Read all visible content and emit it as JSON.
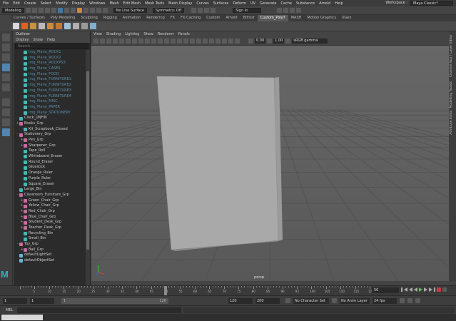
{
  "menubar": {
    "items": [
      "File",
      "Edit",
      "Create",
      "Select",
      "Modify",
      "Display",
      "Windows",
      "Mesh",
      "Edit Mesh",
      "Mesh Tools",
      "Mesh Display",
      "Curves",
      "Surfaces",
      "Deform",
      "UV",
      "Generate",
      "Cache",
      "Substance",
      "Arnold",
      "Help"
    ],
    "workspace_label": "Workspace :",
    "workspace_value": "Maya Classic*"
  },
  "statusline": {
    "mode": "Modeling",
    "live_surface": "No Live Surface",
    "symmetry": "Symmetry: Off",
    "sign_in": "Sign In"
  },
  "shelf_tabs": [
    "Curves / Surfaces",
    "Poly Modeling",
    "Sculpting",
    "Rigging",
    "Animation",
    "Rendering",
    "FX",
    "FX Caching",
    "Custom",
    "Arnold",
    "Bifrost",
    "Custom_PolyT",
    "MASH",
    "Motion Graphics",
    "XGen"
  ],
  "shelf_active_tab": "Custom_PolyT",
  "outliner": {
    "title": "Outliner",
    "menu": [
      "Display",
      "Show",
      "Help"
    ],
    "search_placeholder": "Search...",
    "nodes": [
      {
        "label": "Img_Plane_ROCK1",
        "indent": 1,
        "dim": true,
        "icon": "mesh"
      },
      {
        "label": "Img_Plane_ROCK2",
        "indent": 1,
        "dim": true,
        "icon": "mesh"
      },
      {
        "label": "Img_Plane_ROCKPS3",
        "indent": 1,
        "dim": true,
        "icon": "mesh"
      },
      {
        "label": "Img_Plane_CASES",
        "indent": 1,
        "dim": true,
        "icon": "mesh"
      },
      {
        "label": "Img_Plane_FOOD",
        "indent": 1,
        "dim": true,
        "icon": "mesh"
      },
      {
        "label": "Img_Plane_FURNITURE1",
        "indent": 1,
        "dim": true,
        "icon": "mesh"
      },
      {
        "label": "Img_Plane_FURNITURE2",
        "indent": 1,
        "dim": true,
        "icon": "mesh"
      },
      {
        "label": "Img_Plane_FURNITURE3",
        "indent": 1,
        "dim": true,
        "icon": "mesh"
      },
      {
        "label": "Img_Plane_FURNITURE4",
        "indent": 1,
        "dim": true,
        "icon": "mesh"
      },
      {
        "label": "Img_Plane_MISC",
        "indent": 1,
        "dim": true,
        "icon": "mesh"
      },
      {
        "label": "Img_Plane_PAPER",
        "indent": 1,
        "dim": true,
        "icon": "mesh"
      },
      {
        "label": "Img_Plane_STATIONERY",
        "indent": 1,
        "dim": true,
        "icon": "mesh"
      },
      {
        "label": "Clock_UNFIN",
        "indent": 0,
        "dim": false,
        "icon": "mesh"
      },
      {
        "label": "Books_Grp",
        "indent": 0,
        "dim": false,
        "icon": "grp",
        "exp": "+"
      },
      {
        "label": "Kit_Scrapbook_Closed",
        "indent": 1,
        "dim": false,
        "icon": "mesh"
      },
      {
        "label": "Stationery_Grp",
        "indent": 0,
        "dim": false,
        "icon": "grp",
        "exp": "-"
      },
      {
        "label": "Pen_Grp",
        "indent": 1,
        "dim": false,
        "icon": "grp",
        "exp": "+"
      },
      {
        "label": "Sharpener_Grp",
        "indent": 1,
        "dim": false,
        "icon": "grp",
        "exp": "+"
      },
      {
        "label": "Tape_Roll",
        "indent": 1,
        "dim": false,
        "icon": "mesh"
      },
      {
        "label": "Whiteboard_Eraser",
        "indent": 1,
        "dim": false,
        "icon": "mesh"
      },
      {
        "label": "Round_Eraser",
        "indent": 1,
        "dim": false,
        "icon": "mesh"
      },
      {
        "label": "Gluestick",
        "indent": 1,
        "dim": false,
        "icon": "mesh"
      },
      {
        "label": "Orange_Ruler",
        "indent": 1,
        "dim": false,
        "icon": "mesh"
      },
      {
        "label": "Purple_Ruler",
        "indent": 1,
        "dim": false,
        "icon": "mesh"
      },
      {
        "label": "Square_Eraser",
        "indent": 1,
        "dim": false,
        "icon": "mesh"
      },
      {
        "label": "Large_Bin",
        "indent": 0,
        "dim": false,
        "icon": "mesh"
      },
      {
        "label": "Classroom_Furniture_Grp",
        "indent": 0,
        "dim": false,
        "icon": "grp",
        "exp": "-"
      },
      {
        "label": "Green_Chair_Grp",
        "indent": 1,
        "dim": false,
        "icon": "grp",
        "exp": "+"
      },
      {
        "label": "Yellow_Chair_Grp",
        "indent": 1,
        "dim": false,
        "icon": "grp",
        "exp": "+"
      },
      {
        "label": "Red_Chair_Grp",
        "indent": 1,
        "dim": false,
        "icon": "grp",
        "exp": "+"
      },
      {
        "label": "Blue_Chair_Grp",
        "indent": 1,
        "dim": false,
        "icon": "grp",
        "exp": "+"
      },
      {
        "label": "Student_Desk_Grp",
        "indent": 1,
        "dim": false,
        "icon": "grp",
        "exp": "+"
      },
      {
        "label": "Teacher_Desk_Grp",
        "indent": 1,
        "dim": false,
        "icon": "grp",
        "exp": "+"
      },
      {
        "label": "Recycling_Bin",
        "indent": 1,
        "dim": false,
        "icon": "mesh"
      },
      {
        "label": "Small_Bin",
        "indent": 1,
        "dim": false,
        "icon": "mesh"
      },
      {
        "label": "Toy_Grp",
        "indent": 0,
        "dim": false,
        "icon": "grp",
        "exp": "-"
      },
      {
        "label": "Ball_Grp",
        "indent": 1,
        "dim": false,
        "icon": "grp",
        "exp": "+"
      },
      {
        "label": "defaultLightSet",
        "indent": 0,
        "dim": false,
        "icon": "set"
      },
      {
        "label": "defaultObjectSet",
        "indent": 0,
        "dim": false,
        "icon": "set"
      }
    ]
  },
  "viewport": {
    "menu": [
      "View",
      "Shading",
      "Lighting",
      "Show",
      "Renderer",
      "Panels"
    ],
    "exposure": "0.00",
    "gamma": "1.00",
    "color_space": "sRGB gamma",
    "camera_label": "persp"
  },
  "side_tabs": [
    "Channel Box / Layer Editor",
    "Modelling Toolkit",
    "Attribute Editor"
  ],
  "timeslider": {
    "tick_labels": [
      "5",
      "10",
      "15",
      "20",
      "25",
      "30",
      "35",
      "40",
      "45",
      "50",
      "55",
      "60",
      "65",
      "70",
      "75",
      "80",
      "85",
      "90",
      "95",
      "100",
      "105",
      "110",
      "115",
      "120"
    ],
    "current_frame": "50"
  },
  "range": {
    "start": "1",
    "current": "1",
    "inner_start": "1",
    "inner_end": "120",
    "end": "120",
    "anim_end": "200",
    "character_set": "No Character Set",
    "anim_layer": "No Anim Layer",
    "fps": "24 fps"
  },
  "cmdline": {
    "label": "MEL"
  }
}
